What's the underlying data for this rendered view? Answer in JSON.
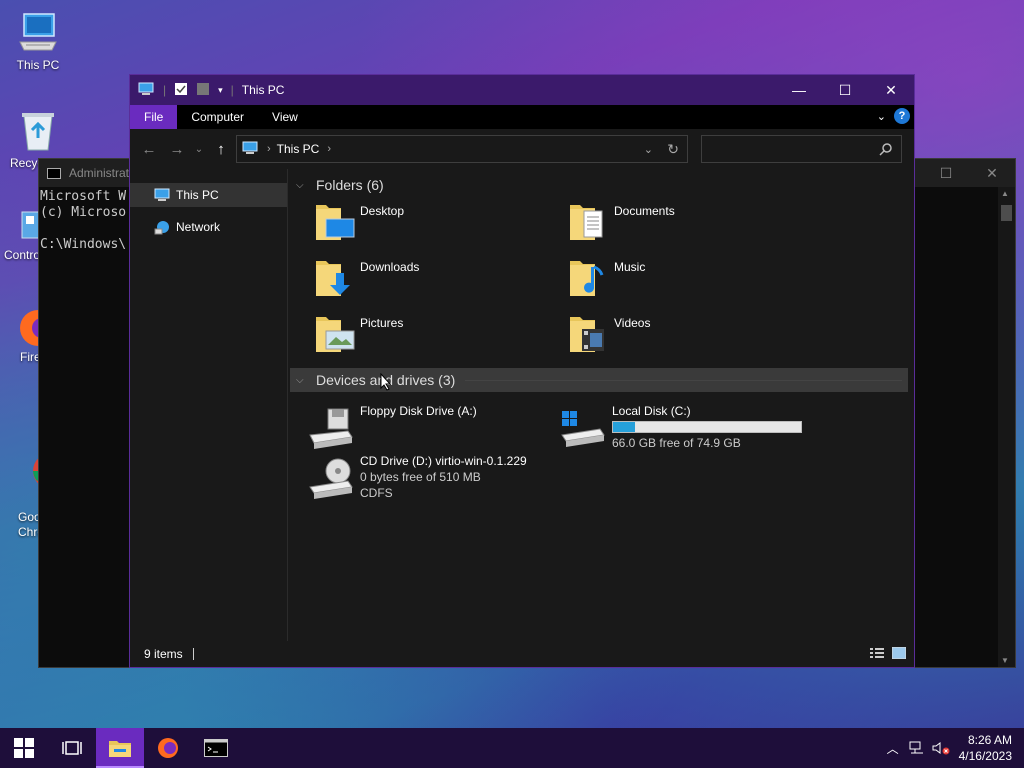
{
  "desktop": {
    "icons": [
      {
        "label": "This PC"
      },
      {
        "label": "Recyc"
      },
      {
        "label": "Contro"
      },
      {
        "label": "Fire"
      },
      {
        "label": "Goo\nChro"
      }
    ]
  },
  "cmd": {
    "title": "Administrat",
    "lines": "Microsoft W\n(c) Microso\n\nC:\\Windows\\"
  },
  "explorer": {
    "title": "This PC",
    "ribbon_tabs": [
      "File",
      "Computer",
      "View"
    ],
    "address": {
      "segment": "This PC"
    },
    "search_placeholder": "",
    "nav_items": [
      {
        "label": "This PC",
        "selected": true
      },
      {
        "label": "Network",
        "selected": false
      }
    ],
    "folders_header": "Folders (6)",
    "folders": [
      {
        "label": "Desktop",
        "icon": "desktop-folder-icon"
      },
      {
        "label": "Documents",
        "icon": "documents-folder-icon"
      },
      {
        "label": "Downloads",
        "icon": "downloads-folder-icon"
      },
      {
        "label": "Music",
        "icon": "music-folder-icon"
      },
      {
        "label": "Pictures",
        "icon": "pictures-folder-icon"
      },
      {
        "label": "Videos",
        "icon": "videos-folder-icon"
      }
    ],
    "devices_header": "Devices and drives (3)",
    "drives": {
      "floppy": {
        "label": "Floppy Disk Drive (A:)"
      },
      "local": {
        "label": "Local Disk (C:)",
        "free_text": "66.0 GB free of 74.9 GB",
        "used_fraction": 0.119
      },
      "cd": {
        "label": "CD Drive (D:) virtio-win-0.1.229",
        "free_text": "0 bytes free of 510 MB",
        "fs": "CDFS"
      }
    },
    "status": "9 items"
  },
  "taskbar": {
    "time": "8:26 AM",
    "date": "4/16/2023"
  },
  "colors": {
    "title_bar": "#3b1a6b",
    "file_tab": "#6a2bbf",
    "taskbar": "#1e0e3a",
    "drive_bar": "#26a0da"
  }
}
